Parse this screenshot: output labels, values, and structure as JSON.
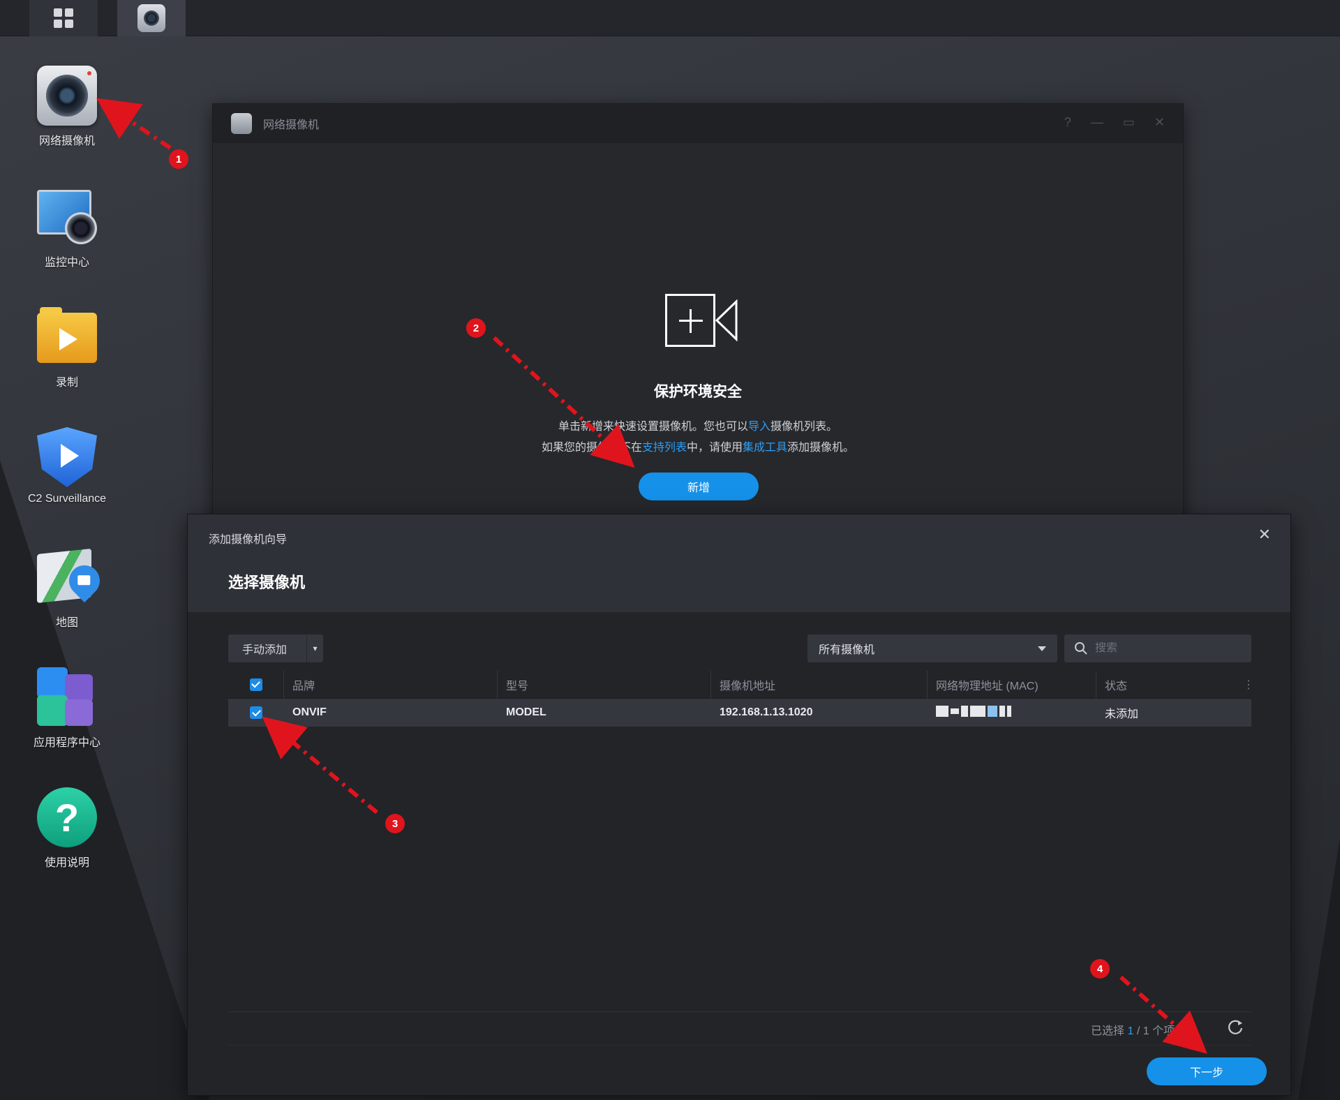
{
  "desktop": {
    "icons": [
      {
        "label": "网络摄像机",
        "icon": "ip-camera-icon"
      },
      {
        "label": "监控中心",
        "icon": "monitor-center-icon"
      },
      {
        "label": "录制",
        "icon": "recording-folder-icon"
      },
      {
        "label": "C2 Surveillance",
        "icon": "c2-surveillance-icon"
      },
      {
        "label": "地图",
        "icon": "map-icon"
      },
      {
        "label": "应用程序中心",
        "icon": "app-center-icon"
      },
      {
        "label": "使用说明",
        "icon": "help-icon"
      }
    ]
  },
  "back_window": {
    "title": "网络摄像机",
    "empty_title": "保护环境安全",
    "line1_pre": "单击新增来快速设置摄像机。您也可以",
    "line1_link": "导入",
    "line1_post": "摄像机列表。",
    "line2_pre": "如果您的摄像机不在",
    "line2_link1": "支持列表",
    "line2_mid": "中，请使用",
    "line2_link2": "集成工具",
    "line2_post": "添加摄像机。",
    "add_button": "新增"
  },
  "wizard": {
    "title": "添加摄像机向导",
    "heading": "选择摄像机",
    "manual_add": "手动添加",
    "filter_value": "所有摄像机",
    "search_placeholder": "搜索",
    "columns": [
      "品牌",
      "型号",
      "摄像机地址",
      "网络物理地址 (MAC)",
      "状态"
    ],
    "rows": [
      {
        "brand": "ONVIF",
        "model": "MODEL",
        "address": "192.168.1.13.1020",
        "status": "未添加"
      }
    ],
    "selection_prefix": "已选择",
    "selection_count": "1",
    "selection_total": "/ 1 个项目",
    "next_button": "下一步"
  },
  "annotations": [
    "1",
    "2",
    "3",
    "4"
  ],
  "colors": {
    "accent": "#1591ea",
    "annotation": "#e0141c",
    "link": "#2d9df3"
  }
}
